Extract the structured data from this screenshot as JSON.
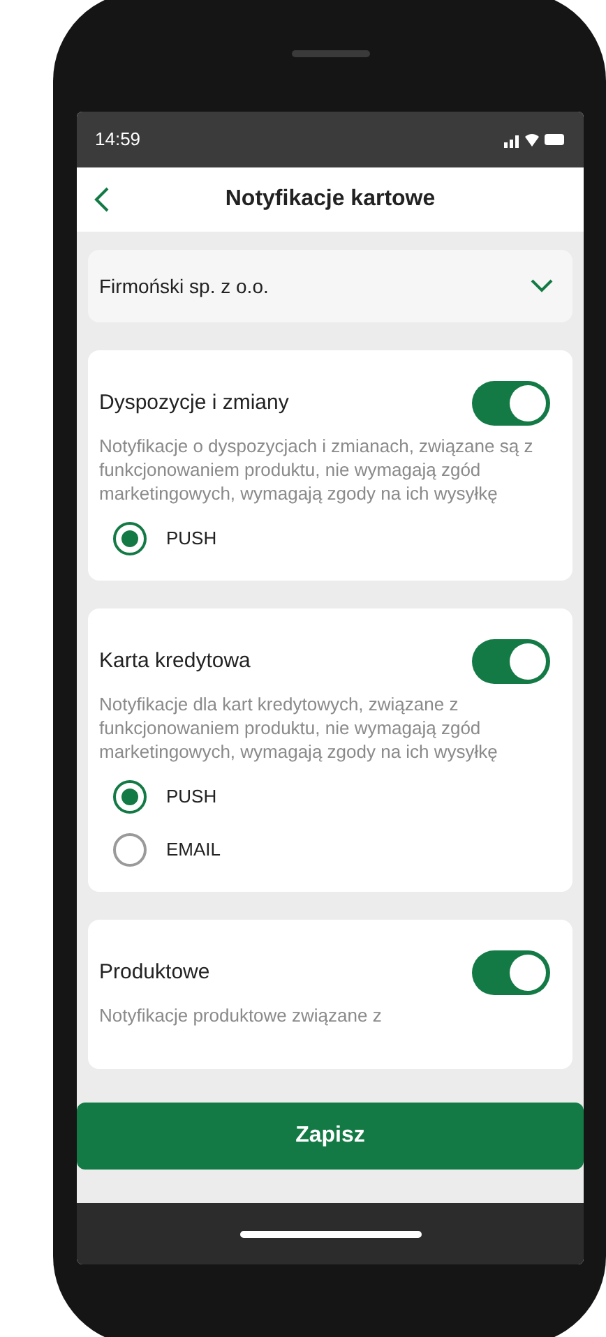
{
  "status_bar": {
    "time": "14:59"
  },
  "header": {
    "title": "Notyfikacje kartowe"
  },
  "company_select": {
    "value": "Firmoński sp. z o.o."
  },
  "sections": [
    {
      "title": "Dyspozycje i zmiany",
      "on": true,
      "description": "Notyfikacje o dyspozycjach i zmianach, związane są z funkcjonowaniem produktu, nie wymagają zgód marketingowych, wymagają zgody na ich wysyłkę",
      "channels": [
        {
          "label": "PUSH",
          "selected": true
        }
      ]
    },
    {
      "title": "Karta kredytowa",
      "on": true,
      "description": "Notyfikacje dla kart kredytowych, związane z funkcjonowaniem produktu, nie wymagają zgód marketingowych, wymagają zgody na ich wysyłkę",
      "channels": [
        {
          "label": "PUSH",
          "selected": true
        },
        {
          "label": "EMAIL",
          "selected": false
        }
      ]
    },
    {
      "title": "Produktowe",
      "on": true,
      "description": "Notyfikacje produktowe związane z"
    }
  ],
  "save_button": "Zapisz"
}
